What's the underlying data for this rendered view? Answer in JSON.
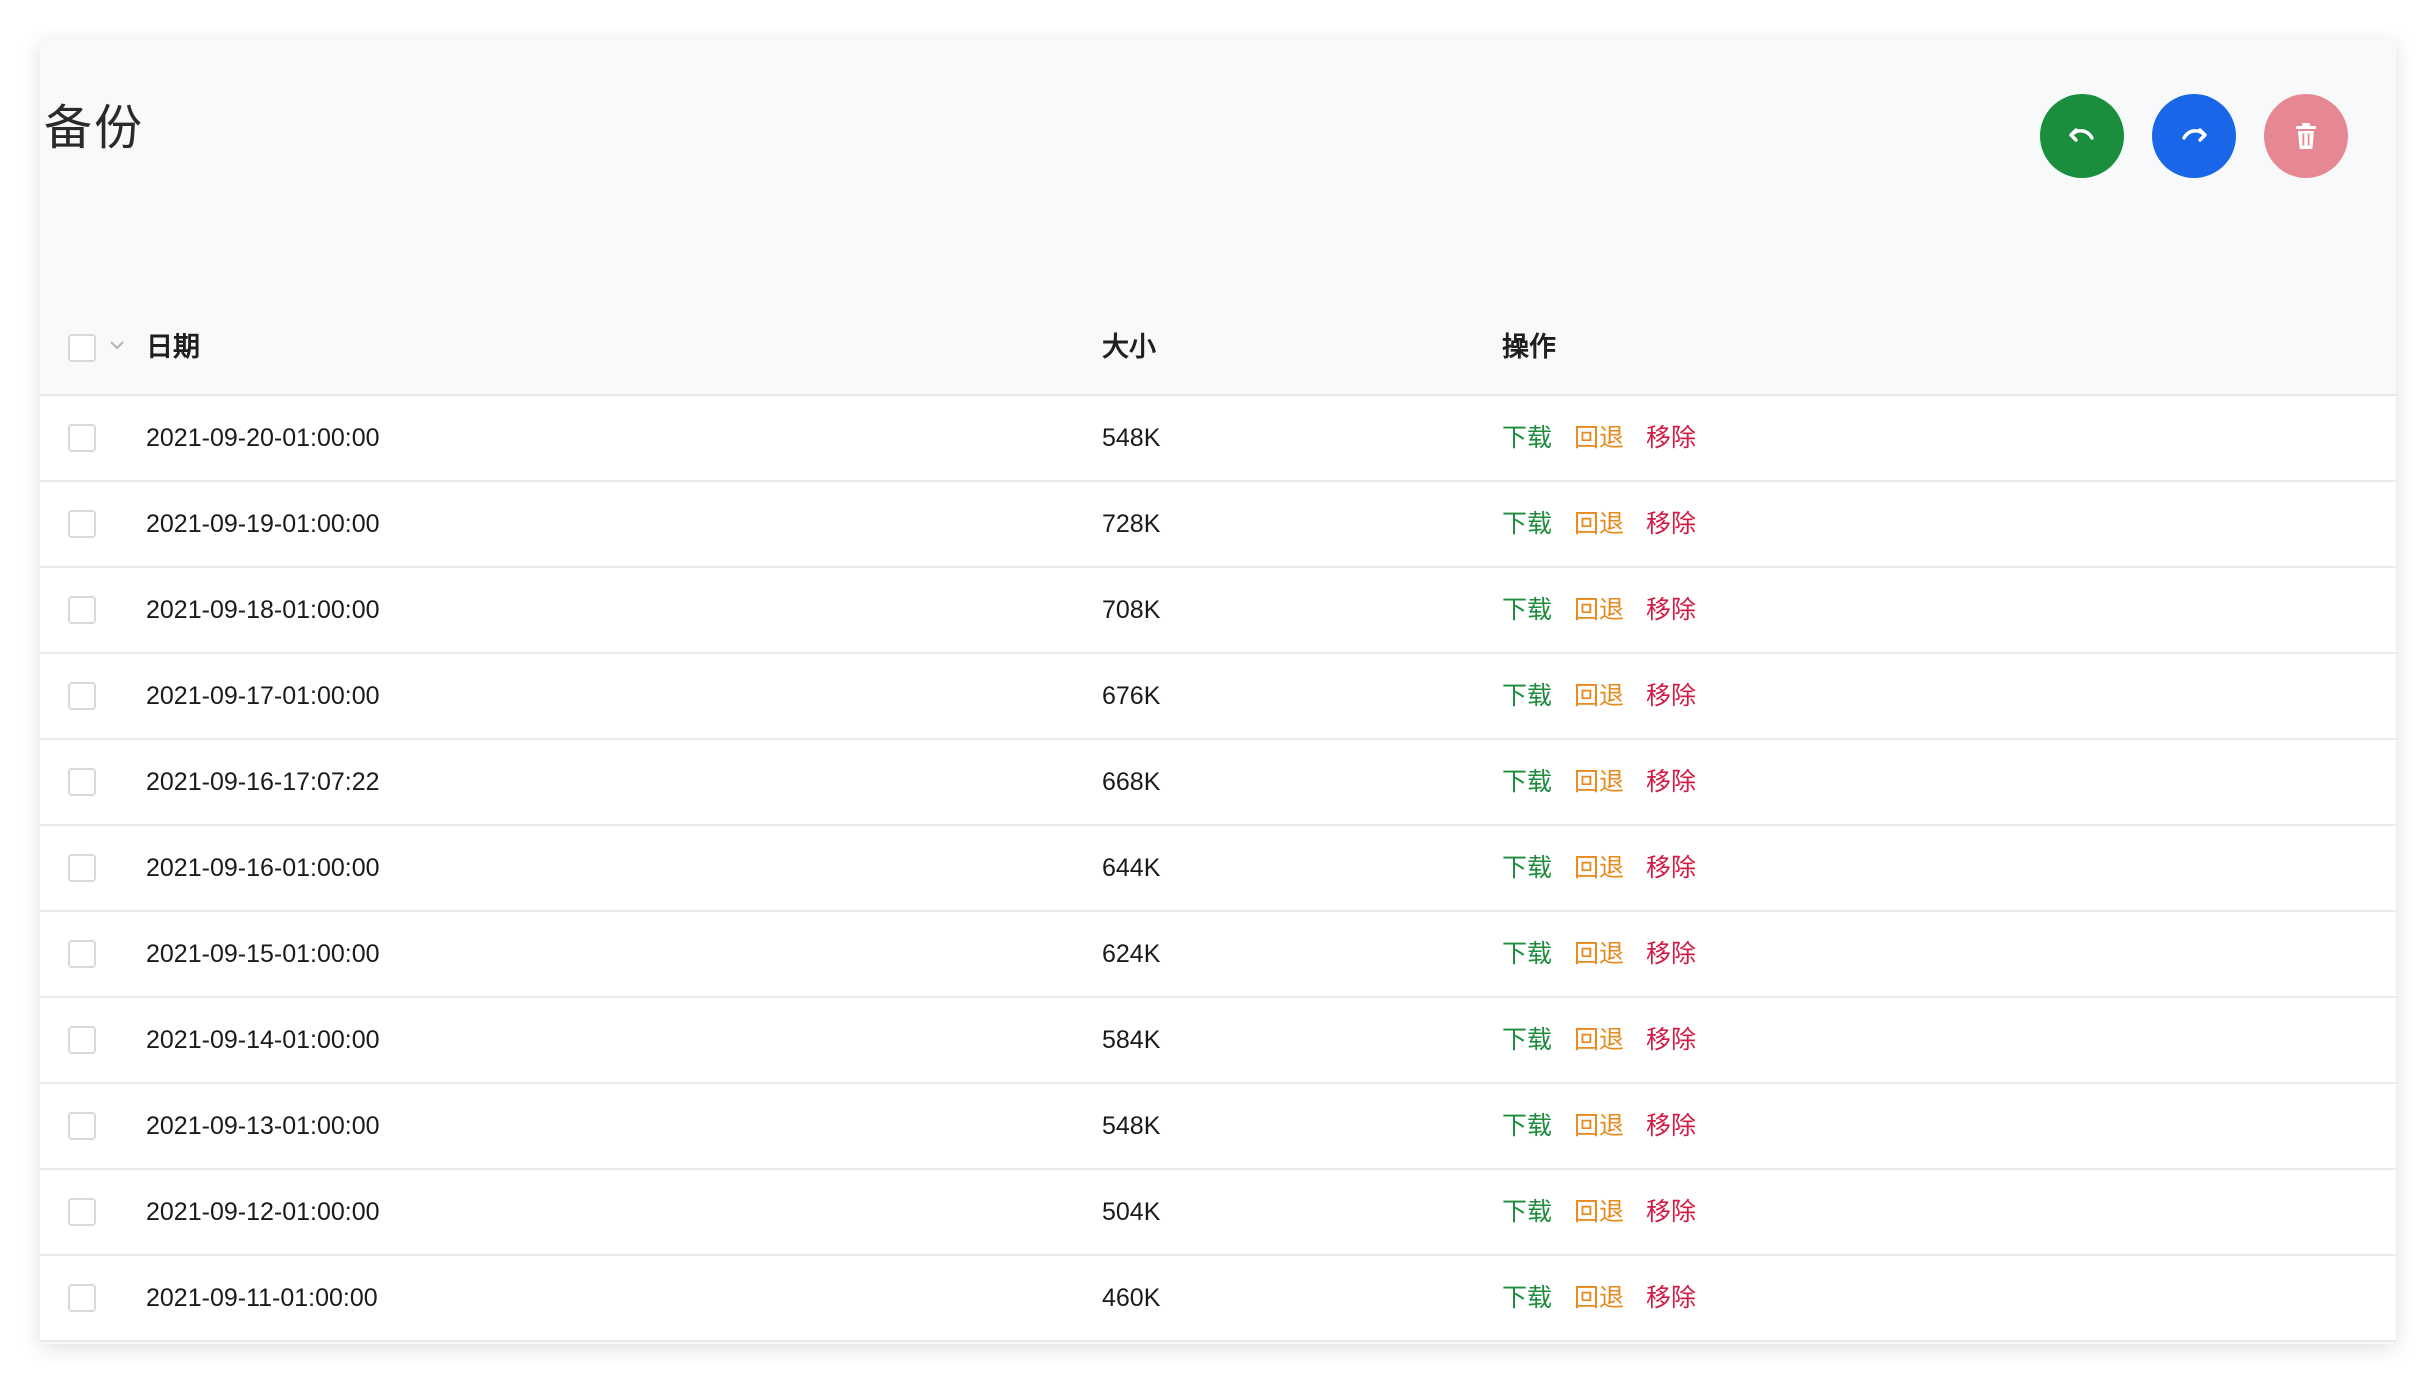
{
  "page": {
    "title": "备份"
  },
  "toolbar": {
    "undo_color": "#1b8e3e",
    "redo_color": "#1a66e8",
    "delete_color": "#e58893",
    "undo_icon": "undo-icon",
    "redo_icon": "redo-icon",
    "delete_icon": "trash-icon"
  },
  "table": {
    "columns": {
      "date": "日期",
      "size": "大小",
      "actions": "操作"
    },
    "action_labels": {
      "download": "下载",
      "rollback": "回退",
      "remove": "移除"
    },
    "action_colors": {
      "download": "#1e8c3c",
      "rollback": "#e8891d",
      "remove": "#d01c45"
    },
    "rows": [
      {
        "date": "2021-09-20-01:00:00",
        "size": "548K"
      },
      {
        "date": "2021-09-19-01:00:00",
        "size": "728K"
      },
      {
        "date": "2021-09-18-01:00:00",
        "size": "708K"
      },
      {
        "date": "2021-09-17-01:00:00",
        "size": "676K"
      },
      {
        "date": "2021-09-16-17:07:22",
        "size": "668K"
      },
      {
        "date": "2021-09-16-01:00:00",
        "size": "644K"
      },
      {
        "date": "2021-09-15-01:00:00",
        "size": "624K"
      },
      {
        "date": "2021-09-14-01:00:00",
        "size": "584K"
      },
      {
        "date": "2021-09-13-01:00:00",
        "size": "548K"
      },
      {
        "date": "2021-09-12-01:00:00",
        "size": "504K"
      },
      {
        "date": "2021-09-11-01:00:00",
        "size": "460K"
      }
    ]
  }
}
